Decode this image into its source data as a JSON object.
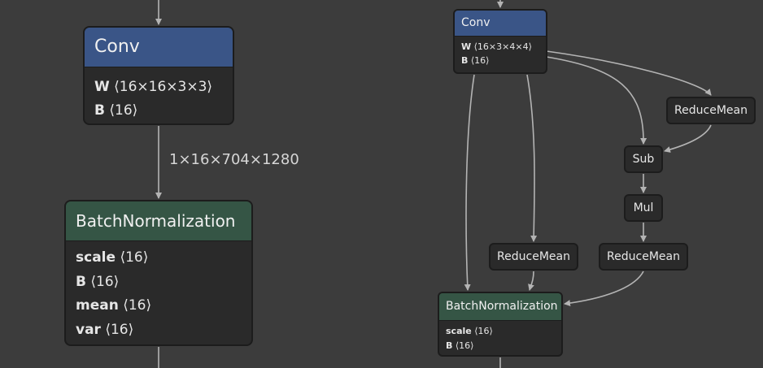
{
  "left_graph": {
    "conv": {
      "title": "Conv",
      "attrs": [
        {
          "name": "W",
          "value": "⟨16×16×3×3⟩"
        },
        {
          "name": "B",
          "value": "⟨16⟩"
        }
      ]
    },
    "edge_label": "1×16×704×1280",
    "batchnorm": {
      "title": "BatchNormalization",
      "attrs": [
        {
          "name": "scale",
          "value": "⟨16⟩"
        },
        {
          "name": "B",
          "value": "⟨16⟩"
        },
        {
          "name": "mean",
          "value": "⟨16⟩"
        },
        {
          "name": "var",
          "value": "⟨16⟩"
        }
      ]
    }
  },
  "right_graph": {
    "conv": {
      "title": "Conv",
      "attrs": [
        {
          "name": "W",
          "value": "⟨16×3×4×4⟩"
        },
        {
          "name": "B",
          "value": "⟨16⟩"
        }
      ]
    },
    "ops": {
      "reducemean_top": "ReduceMean",
      "sub": "Sub",
      "mul": "Mul",
      "reducemean_left": "ReduceMean",
      "reducemean_right": "ReduceMean"
    },
    "batchnorm": {
      "title": "BatchNormalization",
      "attrs": [
        {
          "name": "scale",
          "value": "⟨16⟩"
        },
        {
          "name": "B",
          "value": "⟨16⟩"
        }
      ]
    }
  },
  "colors": {
    "background": "#3c3c3c",
    "node_body": "#2a2a2a",
    "conv_header": "#3a5587",
    "batchnorm_header": "#355545",
    "edge": "#b4b4b4"
  }
}
